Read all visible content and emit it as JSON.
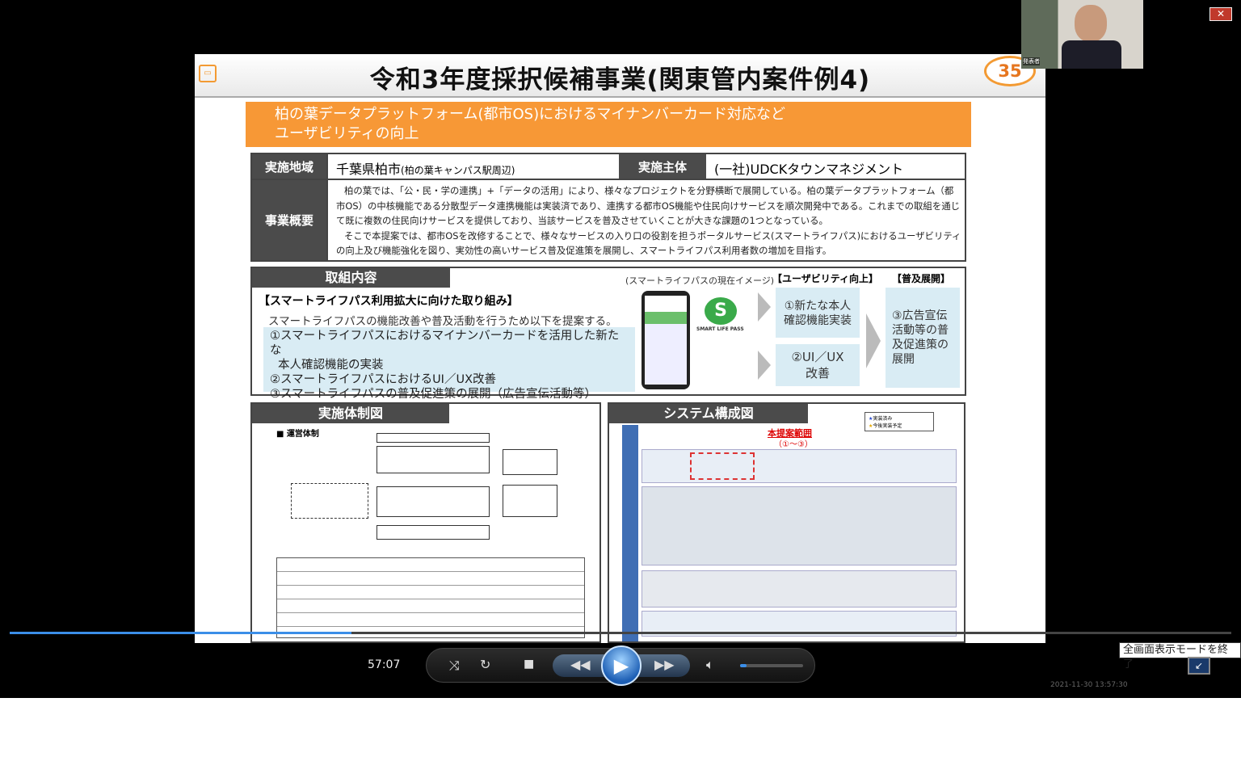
{
  "slide": {
    "title": "令和3年度採択候補事業(関東管内案件例4)",
    "page_number": "35",
    "banner_line1": "柏の葉データプラットフォーム(都市OS)におけるマイナンバーカード対応など",
    "banner_line2": "ユーザビリティの向上",
    "area_label": "実施地域",
    "area_value": "千葉県柏市",
    "area_sub": "(柏の葉キャンパス駅周辺)",
    "org_label": "実施主体",
    "org_value": "(一社)UDCKタウンマネジメント",
    "summary_label": "事業概要",
    "summary_p1": "柏の葉では、「公・民・学の連携」+「データの活用」により、様々なプロジェクトを分野横断で展開している。柏の葉データプラットフォーム（都市OS）の中核機能である分散型データ連携機能は実装済であり、連携する都市OS機能や住民向けサービスを順次開発中である。これまでの取組を通じて既に複数の住民向けサービスを提供しており、当該サービスを普及させていくことが大きな課題の1つとなっている。",
    "summary_p2": "そこで本提案では、都市OSを改修することで、様々なサービスの入り口の役割を担うポータルサービス(スマートライフパス)におけるユーザビリティの向上及び機能強化を図り、実効性の高いサービス普及促進策を展開し、スマートライフパス利用者数の増加を目指す。",
    "torikumi_tab": "取組内容",
    "torikumi_heading": "【スマートライフパス利用拡大に向けた取り組み】",
    "torikumi_intro": "スマートライフパスの機能改善や普及活動を行うため以下を提案する。",
    "torikumi_item1a": "①スマートライフパスにおけるマイナンバーカードを活用した新たな",
    "torikumi_item1b": "本人確認機能の実装",
    "torikumi_item2": "②スマートライフパスにおけるUI／UX改善",
    "torikumi_item3": "③スマートライフパスの普及促進策の展開（広告宣伝活動等）",
    "image_caption": "(スマートライフパスの現在イメージ)",
    "logo_text": "SMART LIFE PASS",
    "usability_header": "【ユーザビリティ向上】",
    "fukyu_header": "【普及展開】",
    "box1": "①新たな本人確認機能実装",
    "box2a": "②UI／UX",
    "box2b": "改善",
    "box3": "③広告宣伝活動等の普及促進策の展開",
    "jisshi_tab": "実施体制図",
    "jisshi_sub": "■ 運営体制",
    "system_tab": "システム構成図",
    "system_red": "本提案範囲",
    "system_red2": "（①～③）",
    "legend1": "実装済み",
    "legend2": "今後実装予定"
  },
  "presenter": {
    "label": "発表者"
  },
  "player": {
    "time": "57:07",
    "exit_fullscreen": "全画面表示モードを終了",
    "timestamp": "2021-11-30 13:57:30",
    "progress": 0.28,
    "volume": 0.1
  }
}
